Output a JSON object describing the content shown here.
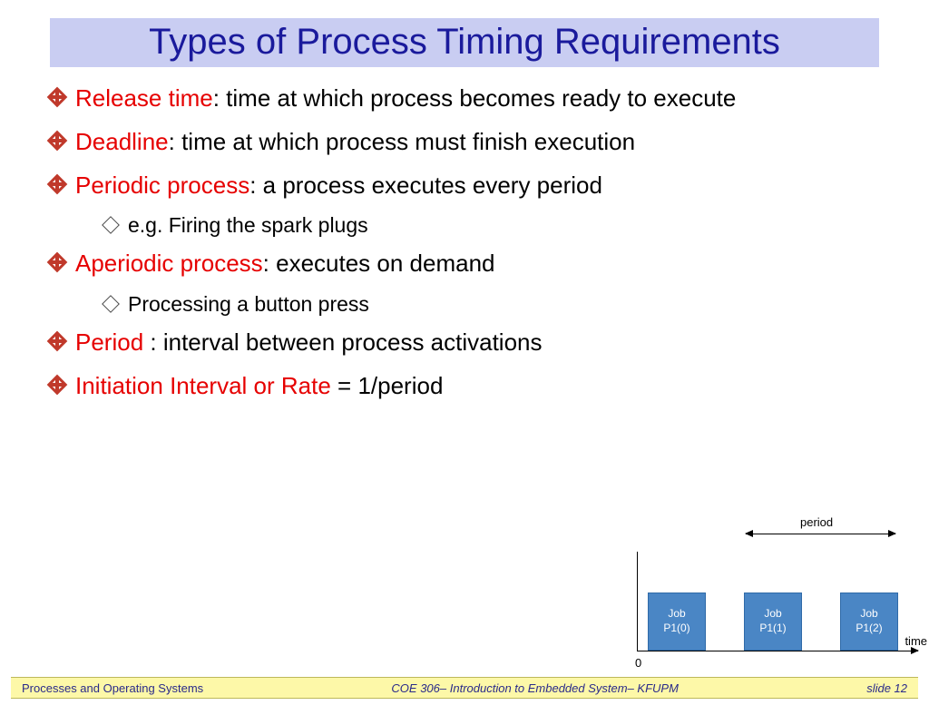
{
  "title": "Types of Process Timing Requirements",
  "bullets": [
    {
      "term": "Release time",
      "rest": ": time at which process becomes ready to execute"
    },
    {
      "term": "Deadline",
      "rest": ": time at which process must finish execution"
    },
    {
      "term": "Periodic process",
      "rest": ": a process executes every period",
      "sub": "e.g. Firing the spark plugs"
    },
    {
      "term": "Aperiodic process",
      "rest": ": executes on demand",
      "sub": "Processing a button press"
    },
    {
      "term": "Period ",
      "rest": ": interval between process activations"
    },
    {
      "term": "Initiation Interval or Rate ",
      "rest": "= 1/period"
    }
  ],
  "diagram": {
    "period_label": "period",
    "time_label": "time",
    "origin_label": "0",
    "jobs": [
      {
        "l1": "Job",
        "l2": "P1(0)"
      },
      {
        "l1": "Job",
        "l2": "P1(1)"
      },
      {
        "l1": "Job",
        "l2": "P1(2)"
      }
    ]
  },
  "footer": {
    "left": "Processes and Operating Systems",
    "center": "COE 306– Introduction to Embedded System– KFUPM",
    "right": "slide 12"
  }
}
